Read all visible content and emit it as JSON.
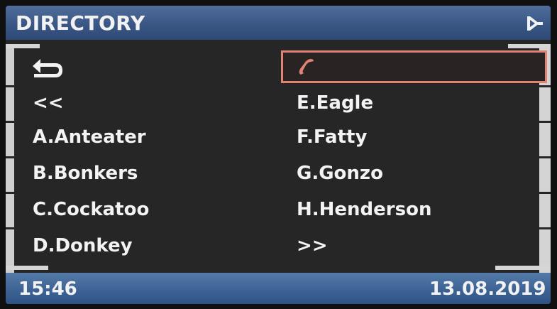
{
  "header": {
    "title": "DIRECTORY",
    "end_icon": "end-marker-icon"
  },
  "menu": {
    "back_icon": "back-return-icon",
    "call_icon": "phone-handset-icon",
    "prev_page": "<<",
    "next_page": ">>",
    "left_entries": [
      "A.Anteater",
      "B.Bonkers",
      "C.Cockatoo",
      "D.Donkey"
    ],
    "right_entries": [
      "E.Eagle",
      "F.Fatty",
      "G.Gonzo",
      "H.Henderson"
    ]
  },
  "status": {
    "time": "15:46",
    "date": "13.08.2019"
  },
  "colors": {
    "title_bar": "#3a5684",
    "status_bar": "#3d6395",
    "selection_border": "#e08274",
    "text": "#f3f3f3",
    "background": "#262626"
  }
}
